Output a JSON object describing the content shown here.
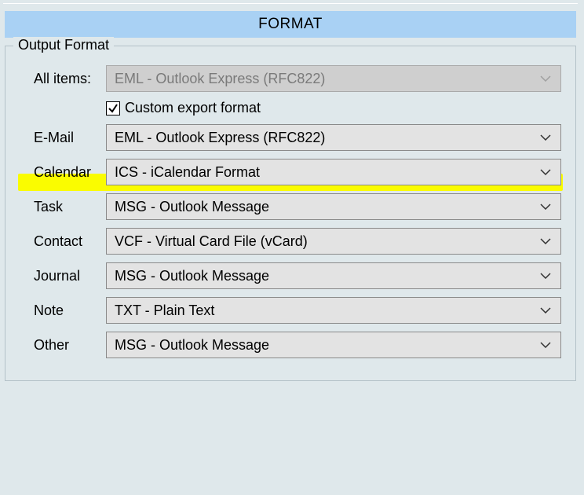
{
  "header": {
    "title": "FORMAT"
  },
  "group": {
    "title": "Output Format"
  },
  "labels": {
    "all_items": "All items:",
    "email": "E-Mail",
    "calendar": "Calendar",
    "task": "Task",
    "contact": "Contact",
    "journal": "Journal",
    "note": "Note",
    "other": "Other"
  },
  "values": {
    "all_items": "EML - Outlook Express (RFC822)",
    "email": "EML - Outlook Express (RFC822)",
    "calendar": "ICS - iCalendar Format",
    "task": "MSG - Outlook Message",
    "contact": "VCF - Virtual Card File (vCard)",
    "journal": "MSG - Outlook Message",
    "note": "TXT - Plain Text",
    "other": "MSG - Outlook Message"
  },
  "checkbox": {
    "custom_label": "Custom export format",
    "custom_checked": true
  }
}
